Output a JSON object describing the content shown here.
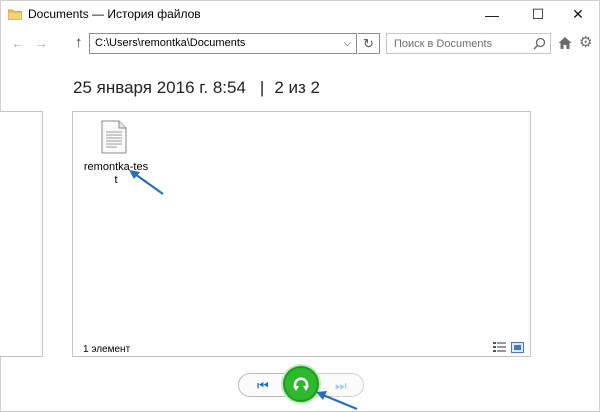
{
  "window": {
    "title": "Documents — История файлов",
    "controls": {
      "minimize": "—",
      "maximize": "☐",
      "close": "✕"
    }
  },
  "nav": {
    "back_glyph": "←",
    "forward_glyph": "→",
    "up_glyph": "↑",
    "address": "C:\\Users\\remontka\\Documents",
    "address_dropdown_glyph": "⌵",
    "refresh_glyph": "↻",
    "search_placeholder": "Поиск в Documents",
    "settings_glyph": "⚙"
  },
  "header": {
    "date": "25 января 2016 г. 8:54",
    "separator": "|",
    "position": "2 из 2"
  },
  "files": [
    {
      "name": "remontka-test",
      "icon": "text-file-icon"
    }
  ],
  "status": {
    "count": "1 элемент"
  },
  "controls": {
    "prev_glyph": "⏮",
    "next_glyph": "⏭",
    "restore_icon": "restore-icon"
  },
  "colors": {
    "accent_blue": "#1e6fd0",
    "restore_green": "#2db82d",
    "annotation_arrow": "#2a6db5"
  }
}
